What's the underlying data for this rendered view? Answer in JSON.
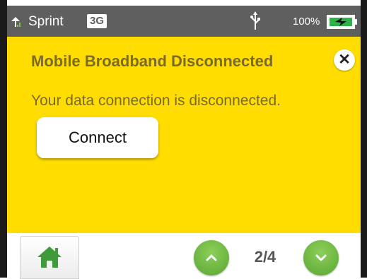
{
  "status_bar": {
    "carrier": "Sprint",
    "network": "3G",
    "battery_percent": "100%",
    "icons": [
      "signal-icon",
      "usb-icon",
      "battery-charging-icon"
    ]
  },
  "panel": {
    "title": "Mobile Broadband Disconnected",
    "close_glyph": "✕",
    "message": "Your data connection is disconnected.",
    "connect_label": "Connect",
    "background_color": "#ffdd00"
  },
  "bottom_bar": {
    "home_icon": "home-icon",
    "page_indicator": "2/4",
    "up_icon": "chevron-up-icon",
    "down_icon": "chevron-down-icon",
    "accent_color": "#6cb83a"
  }
}
